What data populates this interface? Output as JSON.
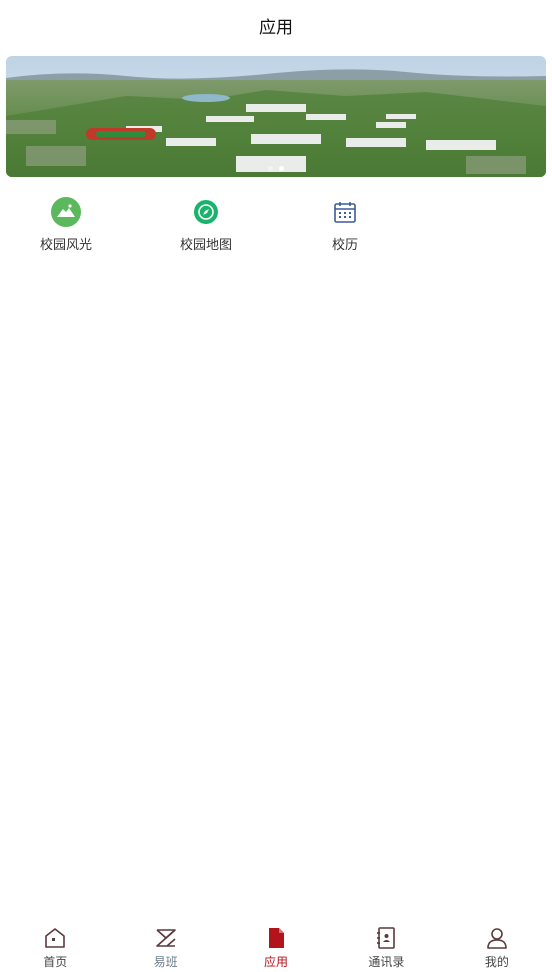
{
  "header": {
    "title": "应用"
  },
  "banner": {
    "slides": 2,
    "active_slide": 1
  },
  "apps": [
    {
      "label": "校园风光",
      "icon": "mountain-icon",
      "color": "#5cb85c"
    },
    {
      "label": "校园地图",
      "icon": "compass-icon",
      "color": "#19b36b"
    },
    {
      "label": "校历",
      "icon": "calendar-icon",
      "color": "#3d5a99"
    }
  ],
  "tabbar": {
    "active_color": "#b3141c",
    "inactive_color": "#5a3a3a",
    "items": [
      {
        "label": "首页",
        "icon": "home-icon",
        "active": false
      },
      {
        "label": "易班",
        "icon": "yiban-icon",
        "active": false
      },
      {
        "label": "应用",
        "icon": "document-icon",
        "active": true
      },
      {
        "label": "通讯录",
        "icon": "contacts-book-icon",
        "active": false
      },
      {
        "label": "我的",
        "icon": "user-icon",
        "active": false
      }
    ]
  }
}
